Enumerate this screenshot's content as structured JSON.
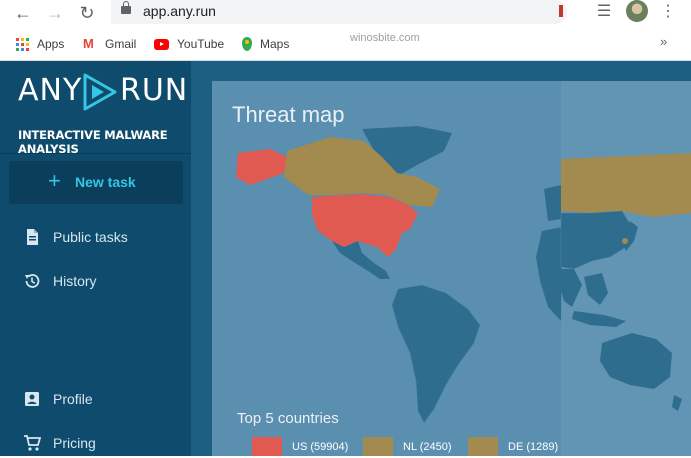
{
  "browser": {
    "url": "app.any.run",
    "bookmarks": [
      {
        "label": "Apps",
        "icon": "apps-icon"
      },
      {
        "label": "Gmail",
        "icon": "gmail-icon"
      },
      {
        "label": "YouTube",
        "icon": "youtube-icon"
      },
      {
        "label": "Maps",
        "icon": "maps-icon"
      }
    ],
    "watermark": "winosbite.com",
    "more_bookmarks": "»"
  },
  "sidebar": {
    "logo_left": "ANY",
    "logo_right": "RUN",
    "tagline": "INTERACTIVE MALWARE ANALYSIS",
    "new_task": "New task",
    "items": [
      {
        "label": "Public tasks",
        "icon": "document-icon"
      },
      {
        "label": "History",
        "icon": "history-icon"
      },
      {
        "label": "Profile",
        "icon": "profile-icon"
      },
      {
        "label": "Pricing",
        "icon": "cart-icon"
      }
    ]
  },
  "threat_map": {
    "title": "Threat map",
    "legend_title": "Top 5 countries",
    "legend": [
      {
        "label": "US (59904)",
        "color": "#e05a52"
      },
      {
        "label": "NL (2450)",
        "color": "#a38a4e"
      },
      {
        "label": "DE (1289)",
        "color": "#a38a4e"
      }
    ]
  },
  "colors": {
    "sidebar_bg": "#0e4b6c",
    "content_bg": "#1c5f82",
    "panel_bg": "#5b8fb0",
    "accent": "#34c6e4",
    "land_default": "#2f6d8f",
    "land_highlight": "#e05a52",
    "land_secondary": "#a38a4e"
  }
}
